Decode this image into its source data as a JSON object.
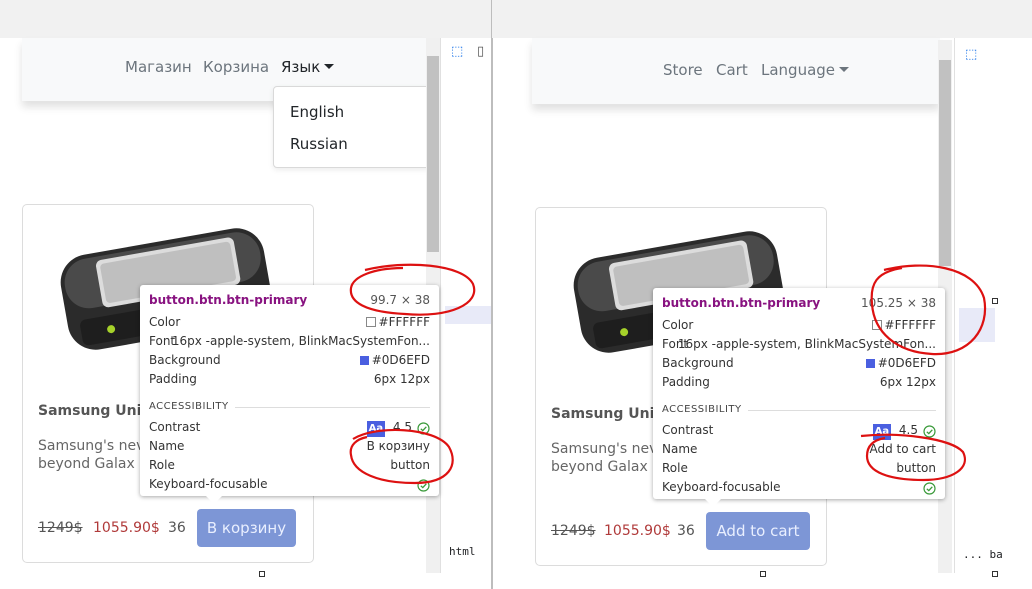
{
  "colors": {
    "annotation": "#dd1111",
    "button_bg": "#7d96d6",
    "price_red": "#b03a3a",
    "devtools_blue": "#1a73e8"
  },
  "left": {
    "nav": {
      "items": [
        "Магазин",
        "Корзина"
      ],
      "language_label": "Язык"
    },
    "dropdown": {
      "options": [
        "English",
        "Russian"
      ]
    },
    "card": {
      "title": "Samsung Univ",
      "text_line1": "Samsung's nev",
      "text_line2": "beyond Galax",
      "old_price": "1249$",
      "new_price": "1055.90$",
      "stock": "36",
      "button_label": "В корзину"
    },
    "tooltip": {
      "selector": "button.btn.btn-primary",
      "dims": "99.7 × 38",
      "color_label": "Color",
      "color_value": "#FFFFFF",
      "font_label": "Font",
      "font_value": "16px -apple-system, BlinkMacSystemFon...",
      "background_label": "Background",
      "background_value": "#0D6EFD",
      "padding_label": "Padding",
      "padding_value": "6px 12px",
      "section": "ACCESSIBILITY",
      "contrast_label": "Contrast",
      "contrast_badge": "Aa",
      "contrast_value": "4.5",
      "name_label": "Name",
      "name_value": "В корзину",
      "role_label": "Role",
      "role_value": "button",
      "focus_label": "Keyboard-focusable"
    },
    "devtools": {
      "tab": "html"
    }
  },
  "right": {
    "nav": {
      "items": [
        "Store",
        "Cart"
      ],
      "language_label": "Language"
    },
    "card": {
      "title": "Samsung Univ",
      "text_line1": "Samsung's nev",
      "text_line2": "beyond Galax",
      "old_price": "1249$",
      "new_price": "1055.90$",
      "stock": "36",
      "button_label": "Add to cart"
    },
    "tooltip": {
      "selector": "button.btn.btn-primary",
      "dims": "105.25 × 38",
      "color_label": "Color",
      "color_value": "#FFFFFF",
      "font_label": "Font",
      "font_value": "16px -apple-system, BlinkMacSystemFon...",
      "background_label": "Background",
      "background_value": "#0D6EFD",
      "padding_label": "Padding",
      "padding_value": "6px 12px",
      "section": "ACCESSIBILITY",
      "contrast_label": "Contrast",
      "contrast_badge": "Aa",
      "contrast_value": "4.5",
      "name_label": "Name",
      "name_value": "Add to cart",
      "role_label": "Role",
      "role_value": "button",
      "focus_label": "Keyboard-focusable"
    },
    "devtools": {
      "tab": "... ba"
    }
  }
}
